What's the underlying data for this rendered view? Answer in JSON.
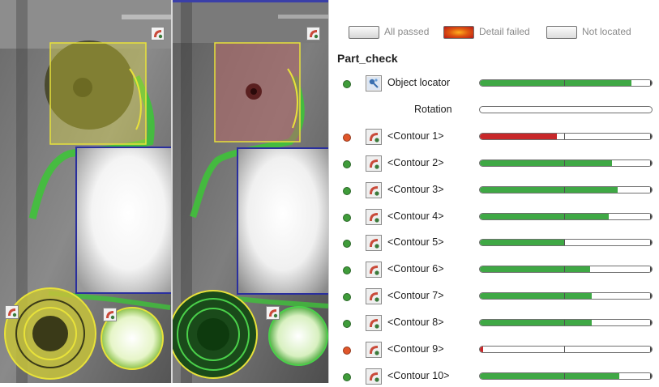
{
  "legend": {
    "all_passed": "All passed",
    "detail_failed": "Detail failed",
    "not_located": "Not located"
  },
  "tree": {
    "title": "Part_check",
    "rows": [
      {
        "label": "Object locator",
        "status": "pass",
        "icon": "object-locator-icon",
        "progress": 0.88,
        "fill": "#3fa845"
      },
      {
        "label": "Rotation",
        "status": "none",
        "icon": "",
        "progress": 0,
        "fill": "#3fa845"
      },
      {
        "label": "<Contour 1>",
        "status": "fail",
        "icon": "contour-tool-icon",
        "progress": 0.45,
        "fill": "#c8282a"
      },
      {
        "label": "<Contour 2>",
        "status": "pass",
        "icon": "contour-tool-icon",
        "progress": 0.77,
        "fill": "#3fa845"
      },
      {
        "label": "<Contour 3>",
        "status": "pass",
        "icon": "contour-tool-icon",
        "progress": 0.8,
        "fill": "#3fa845"
      },
      {
        "label": "<Contour 4>",
        "status": "pass",
        "icon": "contour-tool-icon",
        "progress": 0.75,
        "fill": "#3fa845"
      },
      {
        "label": "<Contour 5>",
        "status": "pass",
        "icon": "contour-tool-icon",
        "progress": 0.49,
        "fill": "#3fa845"
      },
      {
        "label": "<Contour 6>",
        "status": "pass",
        "icon": "contour-tool-icon",
        "progress": 0.64,
        "fill": "#3fa845"
      },
      {
        "label": "<Contour 7>",
        "status": "pass",
        "icon": "contour-tool-icon",
        "progress": 0.65,
        "fill": "#3fa845"
      },
      {
        "label": "<Contour 8>",
        "status": "pass",
        "icon": "contour-tool-icon",
        "progress": 0.65,
        "fill": "#3fa845"
      },
      {
        "label": "<Contour 9>",
        "status": "fail",
        "icon": "contour-tool-icon",
        "progress": 0.02,
        "fill": "#c8282a"
      },
      {
        "label": "<Contour 10>",
        "status": "pass",
        "icon": "contour-tool-icon",
        "progress": 0.81,
        "fill": "#3fa845"
      }
    ]
  },
  "colors": {
    "pass": "#3f9c3a",
    "fail": "#e0562a",
    "bar_pass": "#3fa845",
    "bar_fail": "#c8282a",
    "roi_yellow": "#e8e23a",
    "roi_blue": "#2a2f9e"
  }
}
